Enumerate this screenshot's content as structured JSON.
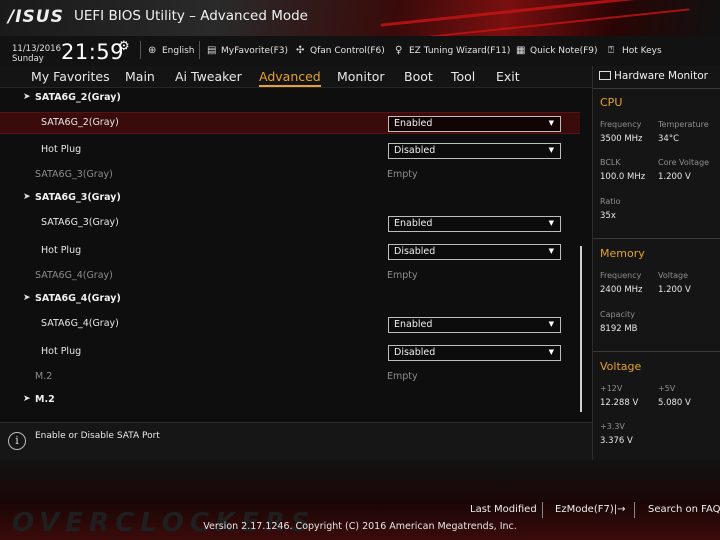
{
  "header": {
    "brand": "/ISUS",
    "title": "UEFI BIOS Utility – Advanced Mode"
  },
  "infobar": {
    "date": "11/13/2016",
    "day": "Sunday",
    "time": "21:59",
    "tools": [
      {
        "icon": "globe-icon",
        "label": "English"
      },
      {
        "icon": "favorite-icon",
        "label": "MyFavorite(F3)"
      },
      {
        "icon": "fan-icon",
        "label": "Qfan Control(F6)"
      },
      {
        "icon": "bulb-icon",
        "label": "EZ Tuning Wizard(F11)"
      },
      {
        "icon": "note-icon",
        "label": "Quick Note(F9)"
      },
      {
        "icon": "question-icon",
        "label": "Hot Keys"
      }
    ]
  },
  "nav": {
    "items": [
      "My Favorites",
      "Main",
      "Ai Tweaker",
      "Advanced",
      "Monitor",
      "Boot",
      "Tool",
      "Exit"
    ],
    "active": "Advanced"
  },
  "rows": [
    {
      "type": "group",
      "label": "SATA6G_2(Gray)"
    },
    {
      "type": "select",
      "label": "SATA6G_2(Gray)",
      "value": "Enabled",
      "selected": true
    },
    {
      "type": "select",
      "label": "Hot Plug",
      "value": "Disabled"
    },
    {
      "type": "info",
      "label": "SATA6G_3(Gray)",
      "value": "Empty"
    },
    {
      "type": "group",
      "label": "SATA6G_3(Gray)"
    },
    {
      "type": "select",
      "label": "SATA6G_3(Gray)",
      "value": "Enabled"
    },
    {
      "type": "select",
      "label": "Hot Plug",
      "value": "Disabled"
    },
    {
      "type": "info",
      "label": "SATA6G_4(Gray)",
      "value": "Empty"
    },
    {
      "type": "group",
      "label": "SATA6G_4(Gray)"
    },
    {
      "type": "select",
      "label": "SATA6G_4(Gray)",
      "value": "Enabled"
    },
    {
      "type": "select",
      "label": "Hot Plug",
      "value": "Disabled"
    },
    {
      "type": "info",
      "label": "M.2",
      "value": "Empty"
    },
    {
      "type": "group",
      "label": "M.2"
    }
  ],
  "help": {
    "text": "Enable or Disable SATA Port"
  },
  "hardware_monitor": {
    "title": "Hardware Monitor",
    "cpu": {
      "heading": "CPU",
      "frequency_label": "Frequency",
      "frequency": "3500 MHz",
      "temperature_label": "Temperature",
      "temperature": "34°C",
      "bclk_label": "BCLK",
      "bclk": "100.0 MHz",
      "core_voltage_label": "Core Voltage",
      "core_voltage": "1.200 V",
      "ratio_label": "Ratio",
      "ratio": "35x"
    },
    "memory": {
      "heading": "Memory",
      "frequency_label": "Frequency",
      "frequency": "2400 MHz",
      "voltage_label": "Voltage",
      "voltage": "1.200 V",
      "capacity_label": "Capacity",
      "capacity": "8192 MB"
    },
    "voltage": {
      "heading": "Voltage",
      "v12_label": "+12V",
      "v12": "12.288 V",
      "v5_label": "+5V",
      "v5": "5.080 V",
      "v33_label": "+3.3V",
      "v33": "3.376 V"
    }
  },
  "footer": {
    "last_modified": "Last Modified",
    "ezmode": "EzMode(F7)|→",
    "search_faq": "Search on FAQ",
    "copyright": "Version 2.17.1246. Copyright (C) 2016 American Megatrends, Inc."
  },
  "colors": {
    "accent": "#e5a22e",
    "selected_row": "#3a0b0b",
    "brand_red": "#c81414"
  }
}
